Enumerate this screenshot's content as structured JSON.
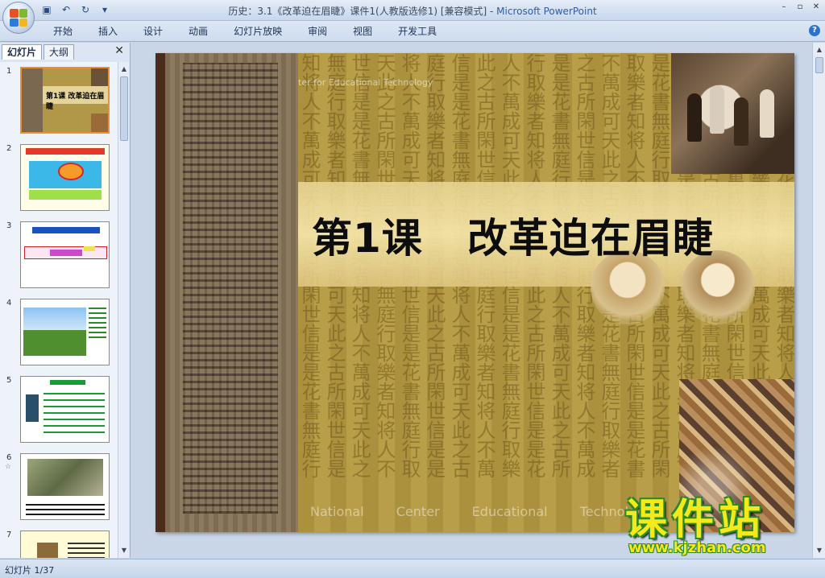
{
  "window": {
    "title_doc": "历史：3.1《改革迫在眉睫》课件1(人教版选修1) [兼容模式] - ",
    "title_app": "Microsoft PowerPoint"
  },
  "ribbon": {
    "tabs": [
      "开始",
      "插入",
      "设计",
      "动画",
      "幻灯片放映",
      "审阅",
      "视图",
      "开发工具"
    ]
  },
  "left_pane": {
    "tab_slides": "幻灯片",
    "tab_outline": "大纲",
    "slide_numbers": [
      "1",
      "2",
      "3",
      "4",
      "5",
      "6",
      "7"
    ],
    "star": "☆"
  },
  "slide": {
    "title": "第1课   改革迫在眉睫",
    "watermark_top": "ter for Educational Technology",
    "watermark_bottom": "National Center  Educational Technology"
  },
  "brand": {
    "name": "课件站",
    "url": "www.kjzhan.com"
  },
  "status": {
    "slide_counter": "幻灯片 1/37"
  },
  "colors": {
    "accent": "#2e5da8",
    "selected_thumb": "#f08f2f",
    "brand_yellow": "#f6e91a",
    "brand_green": "#2a8a2a"
  }
}
